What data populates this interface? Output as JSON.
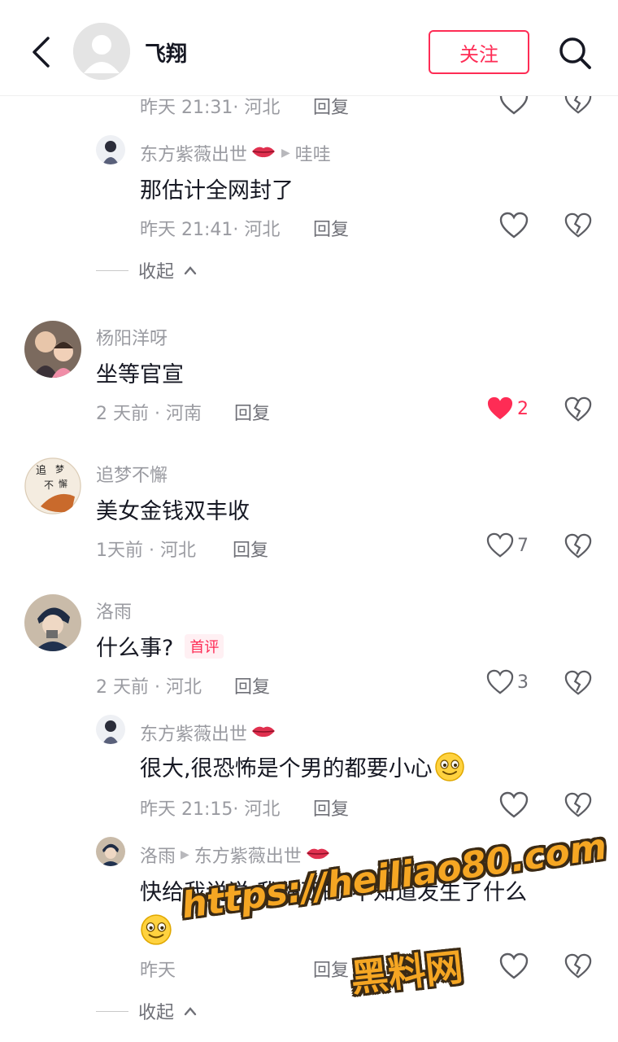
{
  "header": {
    "title": "飞翔",
    "follow_label": "关注"
  },
  "comments": [
    {
      "meta": "昨天 21:31· 河北",
      "reply": "回复"
    },
    {
      "name": "东方紫薇出世",
      "reply_to": "哇哇",
      "text": "那估计全网封了",
      "meta": "昨天 21:41· 河北",
      "reply": "回复"
    },
    {
      "collapse": "收起"
    },
    {
      "name": "杨阳洋呀",
      "text": "坐等官宣",
      "meta": "2 天前 · 河南",
      "reply": "回复",
      "likes": "2"
    },
    {
      "name": "追梦不懈",
      "text": "美女金钱双丰收",
      "meta": "1天前 · 河北",
      "reply": "回复",
      "likes": "7"
    },
    {
      "name": "洛雨",
      "text": "什么事?",
      "tag": "首评",
      "meta": "2 天前 · 河北",
      "reply": "回复",
      "likes": "3"
    },
    {
      "name": "东方紫薇出世",
      "text": "很大,很恐怖是个男的都要小心",
      "meta": "昨天 21:15· 河北",
      "reply": "回复"
    },
    {
      "name": "洛雨",
      "reply_to": "东方紫薇出世",
      "text": "快给我说说 我临西的 不知道发生了什么",
      "meta": "昨天",
      "reply": "回复"
    },
    {
      "collapse": "收起"
    }
  ],
  "avatar_text": {
    "dream_line1": "追",
    "dream_line2": "梦",
    "dream_line3": "不",
    "dream_line4": "懈"
  },
  "watermark": {
    "url": "https://heiliao80.com",
    "site": "黑料网"
  },
  "colors": {
    "accent": "#fe2c55",
    "gray": "#9a9ba1",
    "text": "#161823"
  }
}
